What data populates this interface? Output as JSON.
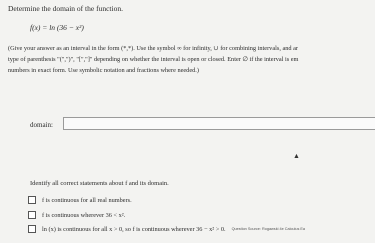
{
  "question": {
    "title": "Determine the domain of the function.",
    "function_text": "f(x) = ln (36 − x²)",
    "instructions": [
      "(Give your answer as an interval in the form (*,*). Use the symbol ∞ for infinity, ∪ for combining intervals, and ar",
      "type of parenthesis \"(\",\")\", \"[\",\"]\" depending on whether the interval is open or closed. Enter ∅ if the interval is em",
      "numbers in exact form. Use symbolic notation and fractions where needed.)"
    ]
  },
  "answer": {
    "label": "domain:",
    "value": ""
  },
  "statements": {
    "prompt": "Identify all correct statements about f and its domain.",
    "options": [
      {
        "text": "f is continuous for all real numbers.",
        "checked": false
      },
      {
        "text": "f is continuous wherever 36 < x².",
        "checked": false
      },
      {
        "text": "ln (x) is continuous for all x > 0, so f is continuous wherever 36 − x² > 0.",
        "checked": false
      }
    ],
    "source": "Question Source: Rogawski 4e Calculus Ea"
  }
}
